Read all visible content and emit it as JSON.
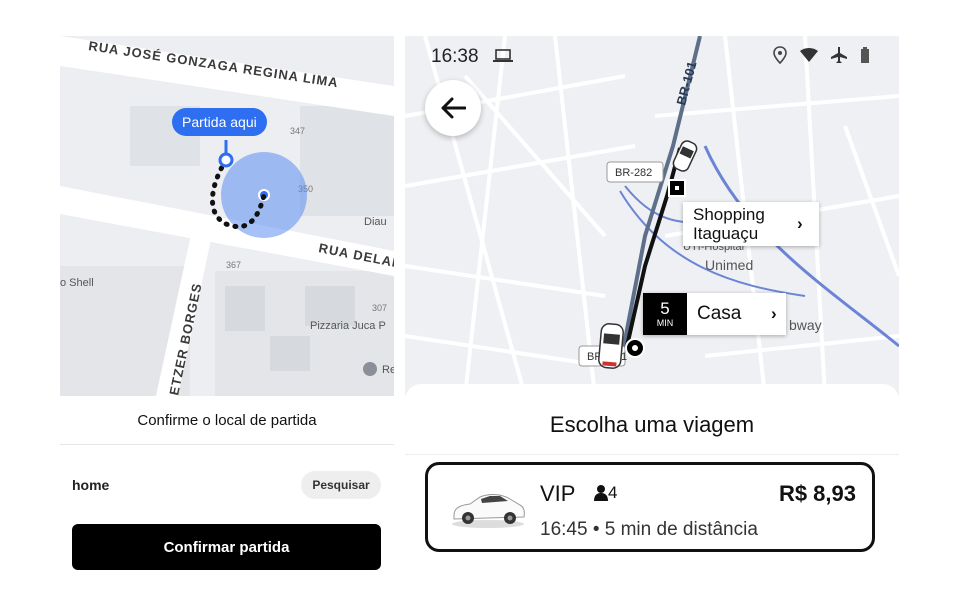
{
  "left_screen": {
    "map": {
      "street_top": "RUA JOSÉ GONZAGA REGINA LIMA",
      "street_right": "RUA DELAM",
      "street_vertical": "ETZER BORGES",
      "pin_label": "Partida aqui",
      "numbers": [
        "347",
        "350",
        "367",
        "307"
      ],
      "poi_shell": "o Shell",
      "poi_diau": "Diau",
      "poi_pizzaria": "Pizzaria Juca P",
      "poi_re": "Re"
    },
    "title": "Confirme o local de partida",
    "address": "home",
    "search_label": "Pesquisar",
    "confirm_label": "Confirmar partida"
  },
  "right_screen": {
    "status": {
      "time": "16:38",
      "icons": [
        "laptop-icon",
        "location-icon",
        "wifi-icon",
        "airplane-icon",
        "battery-icon"
      ]
    },
    "map": {
      "road_br101": "BR-101",
      "badge_br282": "BR-282",
      "badge_br": "BR",
      "badge_suffix": "1",
      "poi_hospital": "UTI-Hospital",
      "poi_unimed": "Unimed",
      "poi_subway": "bway",
      "destination": {
        "name": "Shopping Itaguaçu"
      },
      "pickup": {
        "eta": "5",
        "eta_unit": "MIN",
        "name": "Casa"
      }
    },
    "sheet": {
      "title": "Escolha uma viagem",
      "ride": {
        "name": "VIP",
        "seats": "4",
        "price": "R$ 8,93",
        "detail": "16:45 • 5 min de distância"
      }
    }
  },
  "colors": {
    "accent_blue": "#2e6ef0",
    "route_black": "#111111",
    "route_blue": "#6b84d6"
  }
}
